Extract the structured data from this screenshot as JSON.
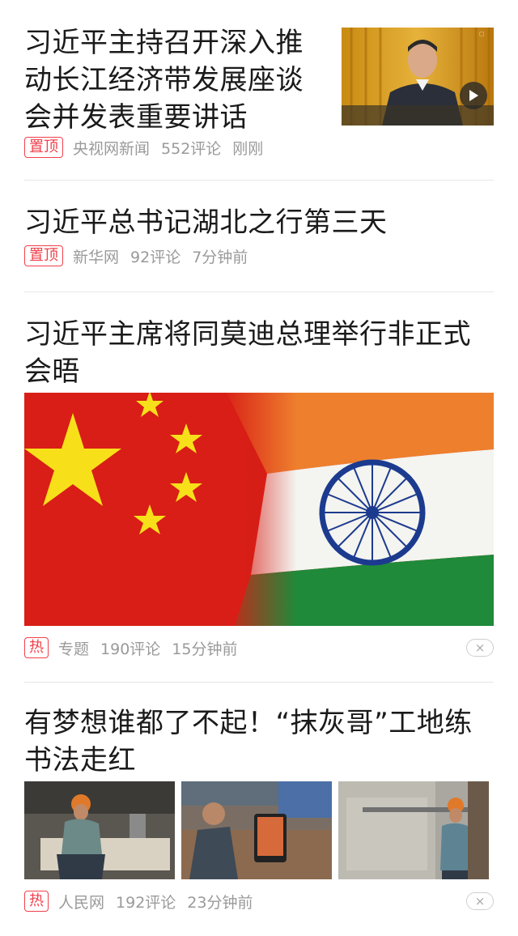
{
  "articles": [
    {
      "title": "习近平主持召开深入推动长江经济带发展座谈会并发表重要讲话",
      "tag": "置顶",
      "source": "央视网新闻",
      "comments": "552评论",
      "time": "刚刚",
      "has_video": true
    },
    {
      "title": "习近平总书记湖北之行第三天",
      "tag": "置顶",
      "source": "新华网",
      "comments": "92评论",
      "time": "7分钟前"
    },
    {
      "title": "习近平主席将同莫迪总理举行非正式会晤",
      "tag": "热",
      "source": "专题",
      "comments": "190评论",
      "time": "15分钟前",
      "dismiss": "×"
    },
    {
      "title": "有梦想谁都了不起！“抹灰哥”工地练书法走红",
      "tag": "热",
      "source": "人民网",
      "comments": "192评论",
      "time": "23分钟前",
      "dismiss": "×"
    }
  ],
  "colors": {
    "tag_red": "#f1404b",
    "meta_gray": "#9a9a9a",
    "divider": "#e6e6e6"
  }
}
